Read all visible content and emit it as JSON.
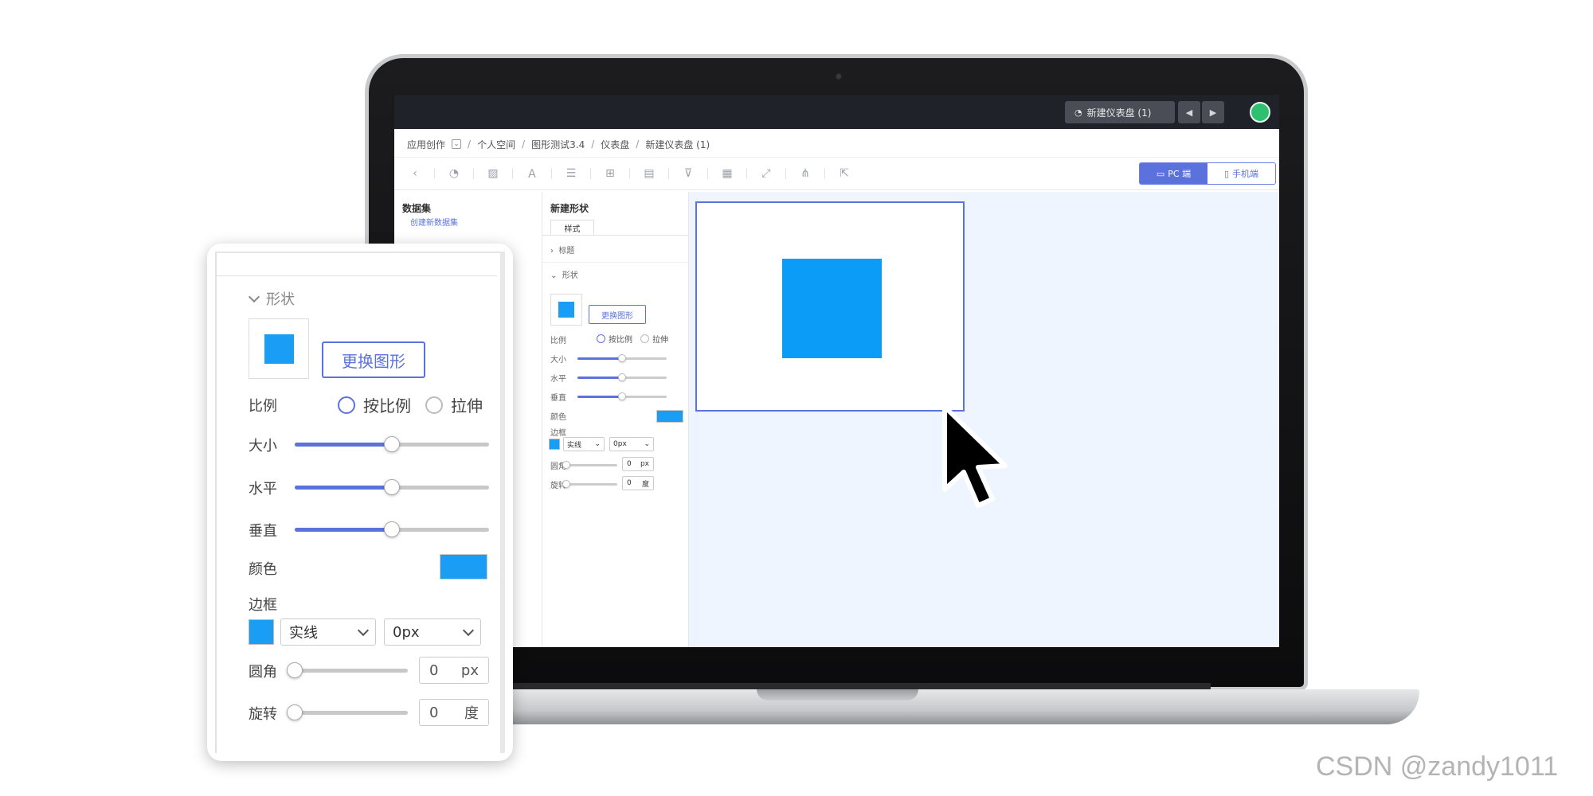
{
  "topbar": {
    "tab_label": "新建仪表盘 (1)",
    "prev_label": "◀",
    "next_label": "▶"
  },
  "breadcrumb": [
    "应用创作",
    "个人空间",
    "图形测试3.4",
    "仪表盘",
    "新建仪表盘 (1)"
  ],
  "device_switch": {
    "pc": "PC 端",
    "mobile": "手机端"
  },
  "data_panel": {
    "title": "数据集",
    "create_link": "创建新数据集"
  },
  "style_panel": {
    "title": "新建形状",
    "tab": "样式",
    "title_section": "标题",
    "shape_section": "形状",
    "change_shape": "更换图形",
    "ratio_label": "比例",
    "ratio_options": [
      "按比例",
      "拉伸"
    ],
    "size_label": "大小",
    "horizontal_label": "水平",
    "vertical_label": "垂直",
    "color_label": "颜色",
    "border_label": "边框",
    "border_style": "实线",
    "border_width": "0px",
    "radius_label": "圆角",
    "radius_value": "0",
    "radius_unit": "px",
    "rotate_label": "旋转",
    "rotate_value": "0",
    "rotate_unit": "度"
  },
  "sliders": {
    "size": 0.5,
    "horizontal": 0.5,
    "vertical": 0.5,
    "radius": 0,
    "rotate": 0
  },
  "colors": {
    "accent": "#5b72dc",
    "shape_fill": "#1a9df4",
    "canvas_bg": "#eef5fe"
  },
  "watermark": "CSDN @zandy1011"
}
